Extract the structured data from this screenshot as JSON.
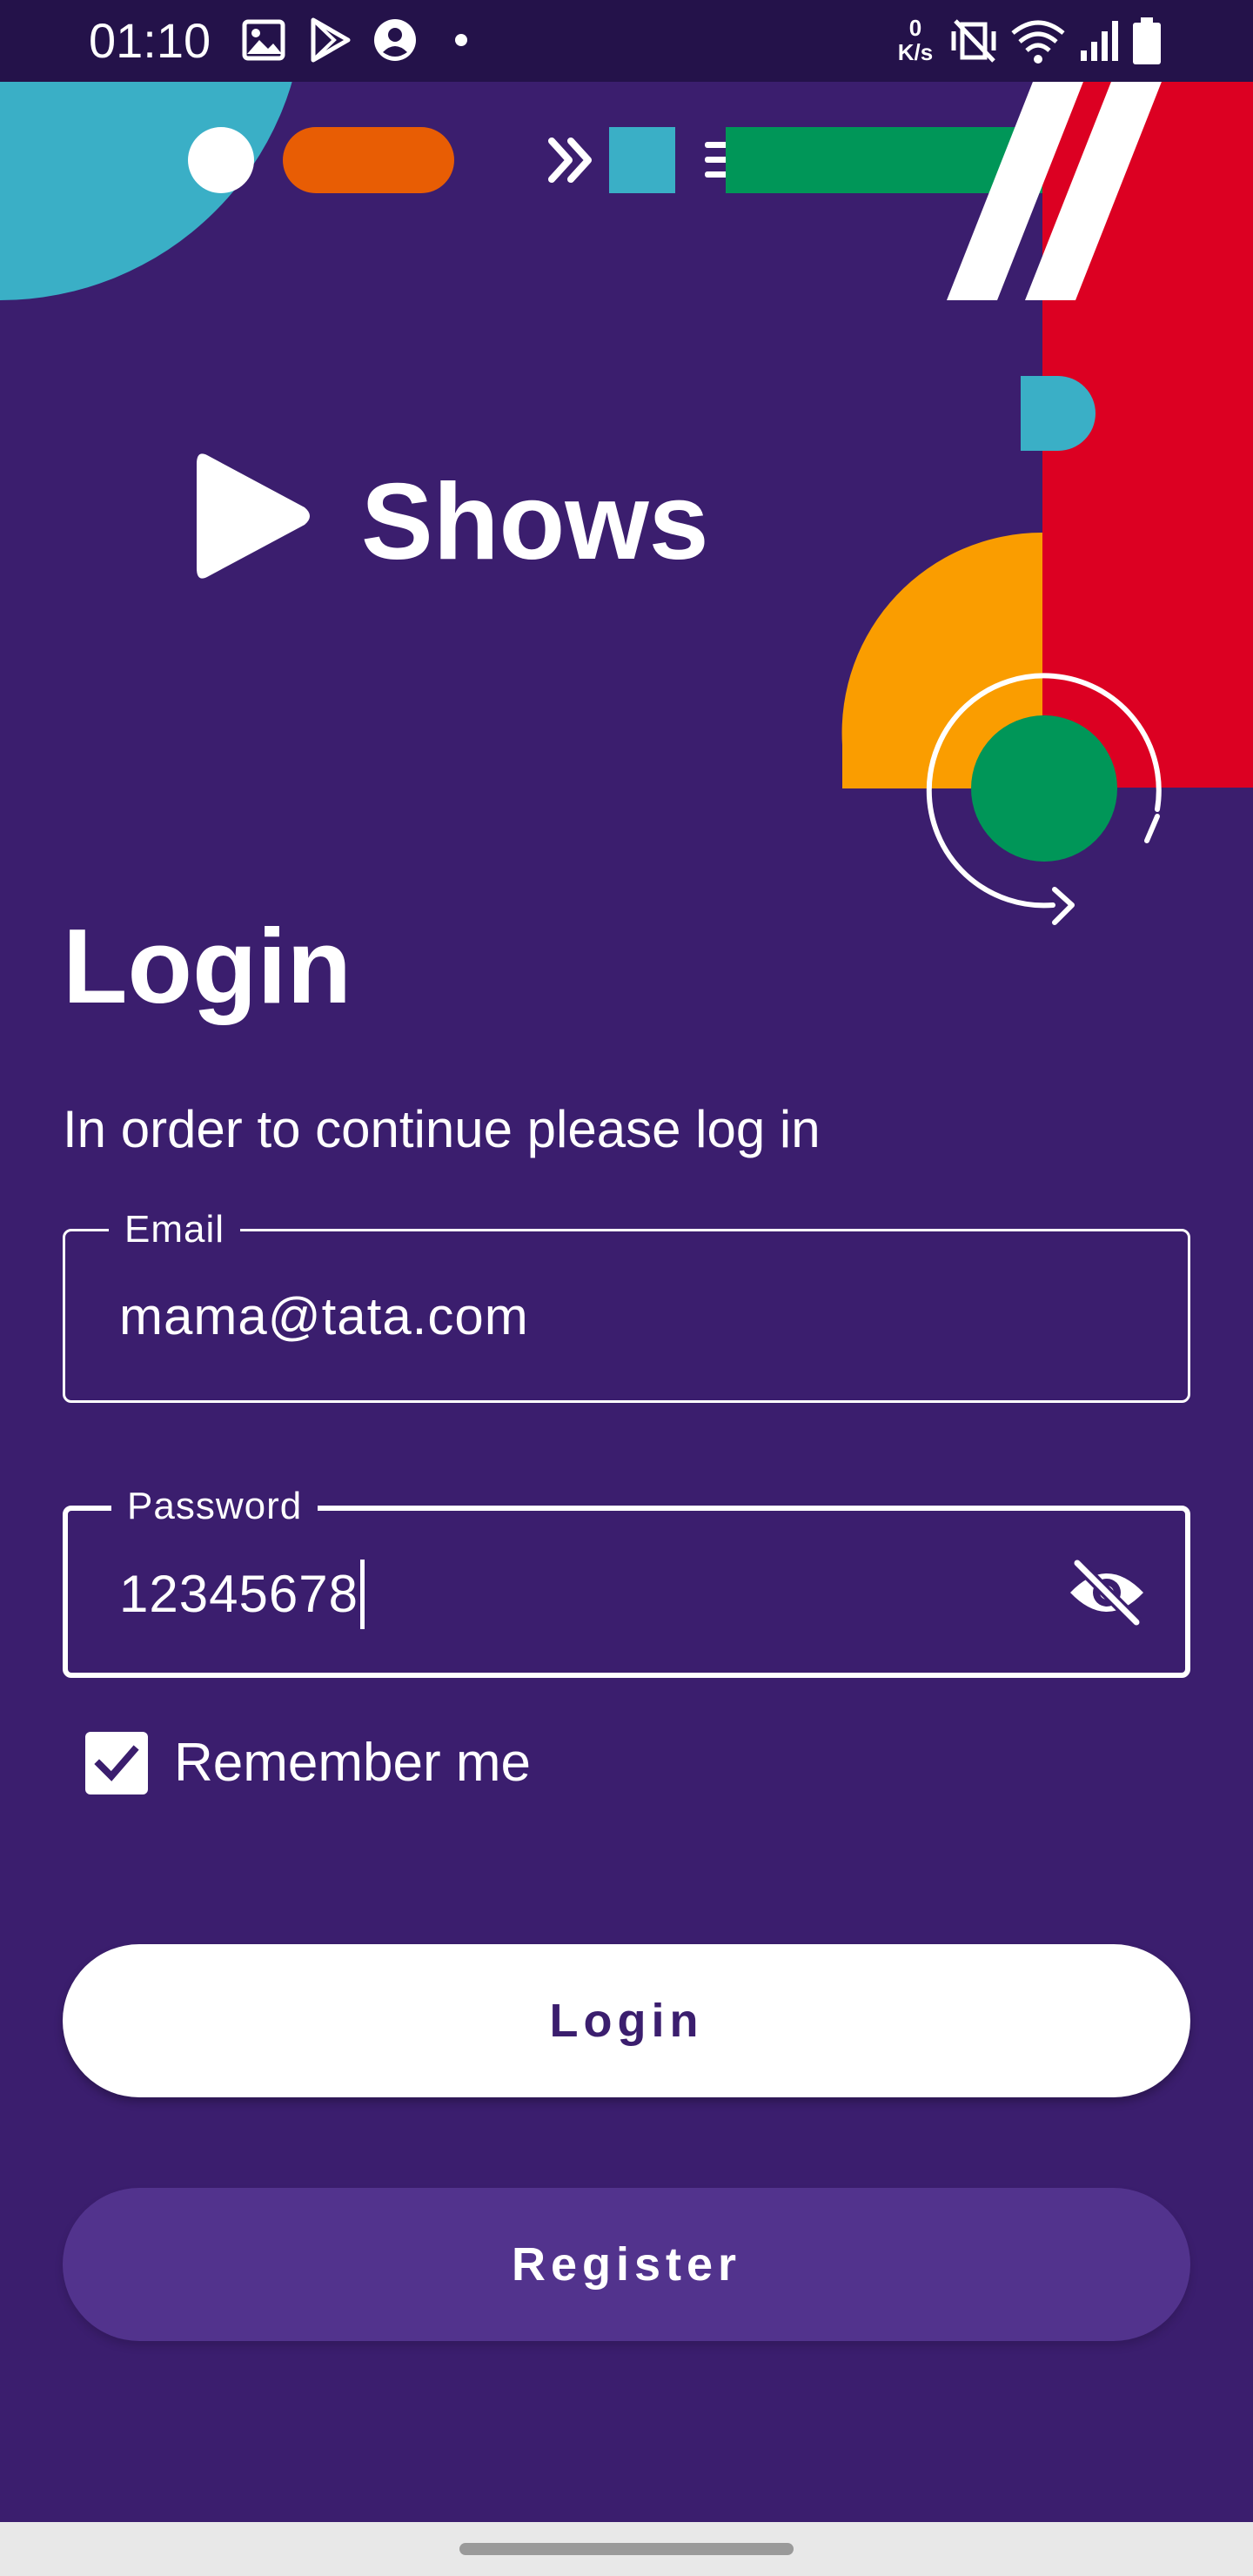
{
  "status_bar": {
    "time": "01:10",
    "net_speed_value": "0",
    "net_speed_unit": "K/s",
    "icons": [
      "gallery-icon",
      "play-store-icon",
      "account-icon",
      "dot-icon",
      "mute-icon",
      "wifi-icon",
      "signal-icon",
      "battery-icon"
    ]
  },
  "app": {
    "logo_text": "Shows"
  },
  "login": {
    "title": "Login",
    "subtitle": "In order to continue please log in",
    "email": {
      "label": "Email",
      "value": "mama@tata.com"
    },
    "password": {
      "label": "Password",
      "value": "12345678",
      "toggle_icon": "eye-off-icon"
    },
    "remember_me": {
      "label": "Remember me",
      "checked": true
    },
    "login_button": "Login",
    "register_button": "Register"
  },
  "colors": {
    "background": "#3B1E6E",
    "status_bar": "#24124A",
    "login_button_bg": "#FFFFFF",
    "register_button_bg": "#52338D",
    "accent_teal": "#3AAFC6",
    "accent_orange": "#E85D04",
    "accent_green": "#009658",
    "accent_red": "#DC0022",
    "accent_yellow": "#FA9D00"
  }
}
